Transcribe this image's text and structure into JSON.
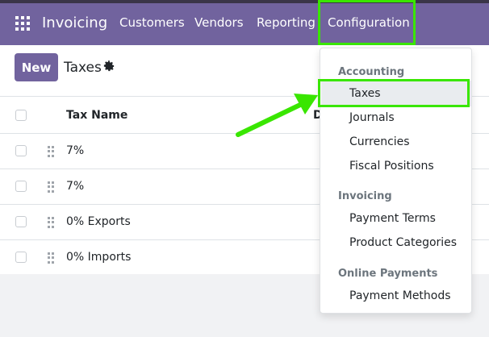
{
  "nav": {
    "brand": "Invoicing",
    "items": [
      "Customers",
      "Vendors",
      "Reporting",
      "Configuration"
    ],
    "icons": {
      "apps": "apps-grid-icon"
    }
  },
  "control": {
    "new_label": "New",
    "title": "Taxes",
    "icons": {
      "settings": "gear-icon"
    }
  },
  "table": {
    "headers": {
      "tax_name": "Tax Name",
      "partial": "D"
    },
    "rows": [
      "7%",
      "7%",
      "0% Exports",
      "0% Imports"
    ]
  },
  "dropdown": {
    "sections": [
      {
        "header": "Accounting",
        "items": [
          "Taxes",
          "Journals",
          "Currencies",
          "Fiscal Positions"
        ]
      },
      {
        "header": "Invoicing",
        "items": [
          "Payment Terms",
          "Product Categories"
        ]
      },
      {
        "header": "Online Payments",
        "items": [
          "Payment Methods"
        ]
      }
    ],
    "selected": "Taxes"
  },
  "colors": {
    "primary": "#71639e",
    "highlight": "#39e600"
  }
}
